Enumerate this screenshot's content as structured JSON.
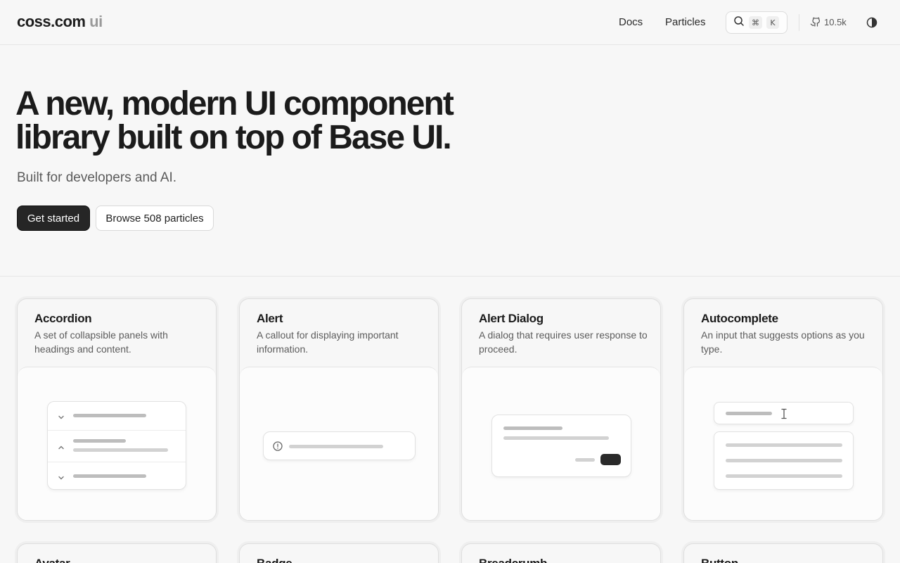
{
  "header": {
    "brand": "coss.com",
    "brand_suffix": "ui",
    "nav": [
      "Docs",
      "Particles"
    ],
    "search_kbd": [
      "⌘",
      "K"
    ],
    "stars": "10.5k"
  },
  "hero": {
    "title_line1": "A new, modern UI component",
    "title_line2": "library built on top of Base UI.",
    "subtitle": "Built for developers and AI.",
    "primary_cta": "Get started",
    "secondary_cta": "Browse 508 particles"
  },
  "cards": [
    {
      "title": "Accordion",
      "description": "A set of collapsible panels with headings and content."
    },
    {
      "title": "Alert",
      "description": "A callout for displaying important information."
    },
    {
      "title": "Alert Dialog",
      "description": "A dialog that requires user response to proceed."
    },
    {
      "title": "Autocomplete",
      "description": "An input that suggests options as you type."
    }
  ],
  "cards_next": [
    "Avatar",
    "Badge",
    "Breadcrumb",
    "Button"
  ],
  "colors": {
    "background": "#f7f7f7",
    "primary_button": "#262626",
    "text": "#1b1b1b",
    "muted_text": "#5c5c5c"
  }
}
